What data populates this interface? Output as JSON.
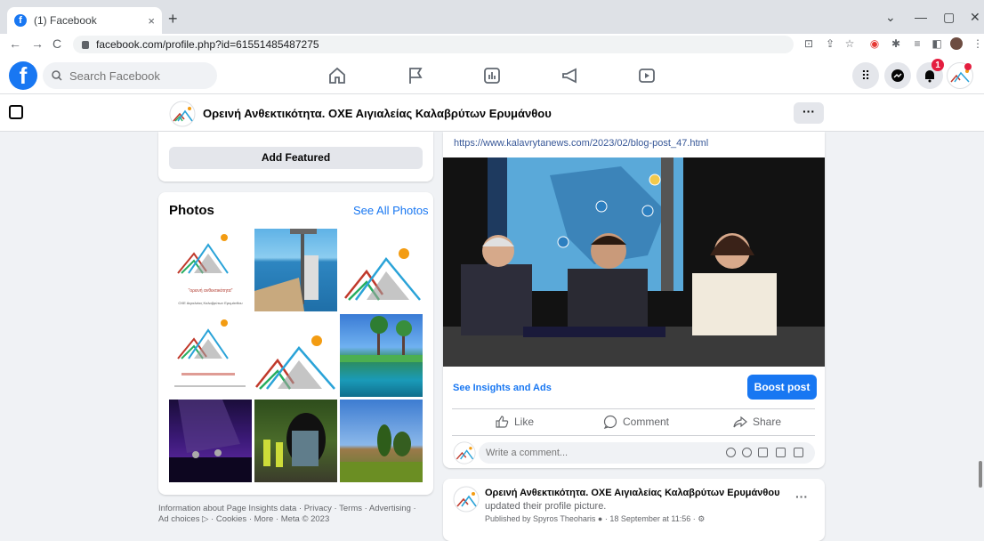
{
  "browser": {
    "tab_title": "(1) Facebook",
    "tab_close": "×",
    "new_tab": "+",
    "url": "facebook.com/profile.php?id=61551485487275",
    "back": "←",
    "forward": "→",
    "reload": "C"
  },
  "facebook": {
    "logo": "f",
    "search_placeholder": "Search Facebook",
    "notification_count": "1"
  },
  "page": {
    "name": "Ορεινή Ανθεκτικότητα. ΟΧΕ Αιγιαλείας Καλαβρύτων Ερυμάνθου",
    "more": "···"
  },
  "left": {
    "add_featured": "Add Featured",
    "photos_title": "Photos",
    "see_all_photos": "See All Photos",
    "logo_caption": "\"ορεινή ανθεκτικότητα\"",
    "logo_subcaption": "ΟΧΕ Αιγιαλείας Καλαβρύτων Ερυμάνθου",
    "footer": "Information about Page Insights data · Privacy · Terms · Advertising · Ad choices ▷ · Cookies · More · Meta © 2023"
  },
  "post": {
    "link": "https://www.kalavrytanews.com/2023/02/blog-post_47.html",
    "see_insights": "See Insights and Ads",
    "boost": "Boost post",
    "like": "Like",
    "comment": "Comment",
    "share": "Share",
    "comment_placeholder": "Write a comment..."
  },
  "post2": {
    "author": "Ορεινή Ανθεκτικότητα. ΟΧΕ Αιγιαλείας Καλαβρύτων Ερυμάνθου",
    "action": "updated their profile picture.",
    "meta": "Published by Spyros Theoharis",
    "date": "· 18 September at 11:56 ·",
    "more": "···"
  },
  "colors": {
    "fb_blue": "#1877f2",
    "logo_red": "#c0392b",
    "logo_green": "#27ae60",
    "logo_blue": "#2aa3d8",
    "logo_grey": "#9e9e9e",
    "logo_sun": "#f39c12"
  }
}
